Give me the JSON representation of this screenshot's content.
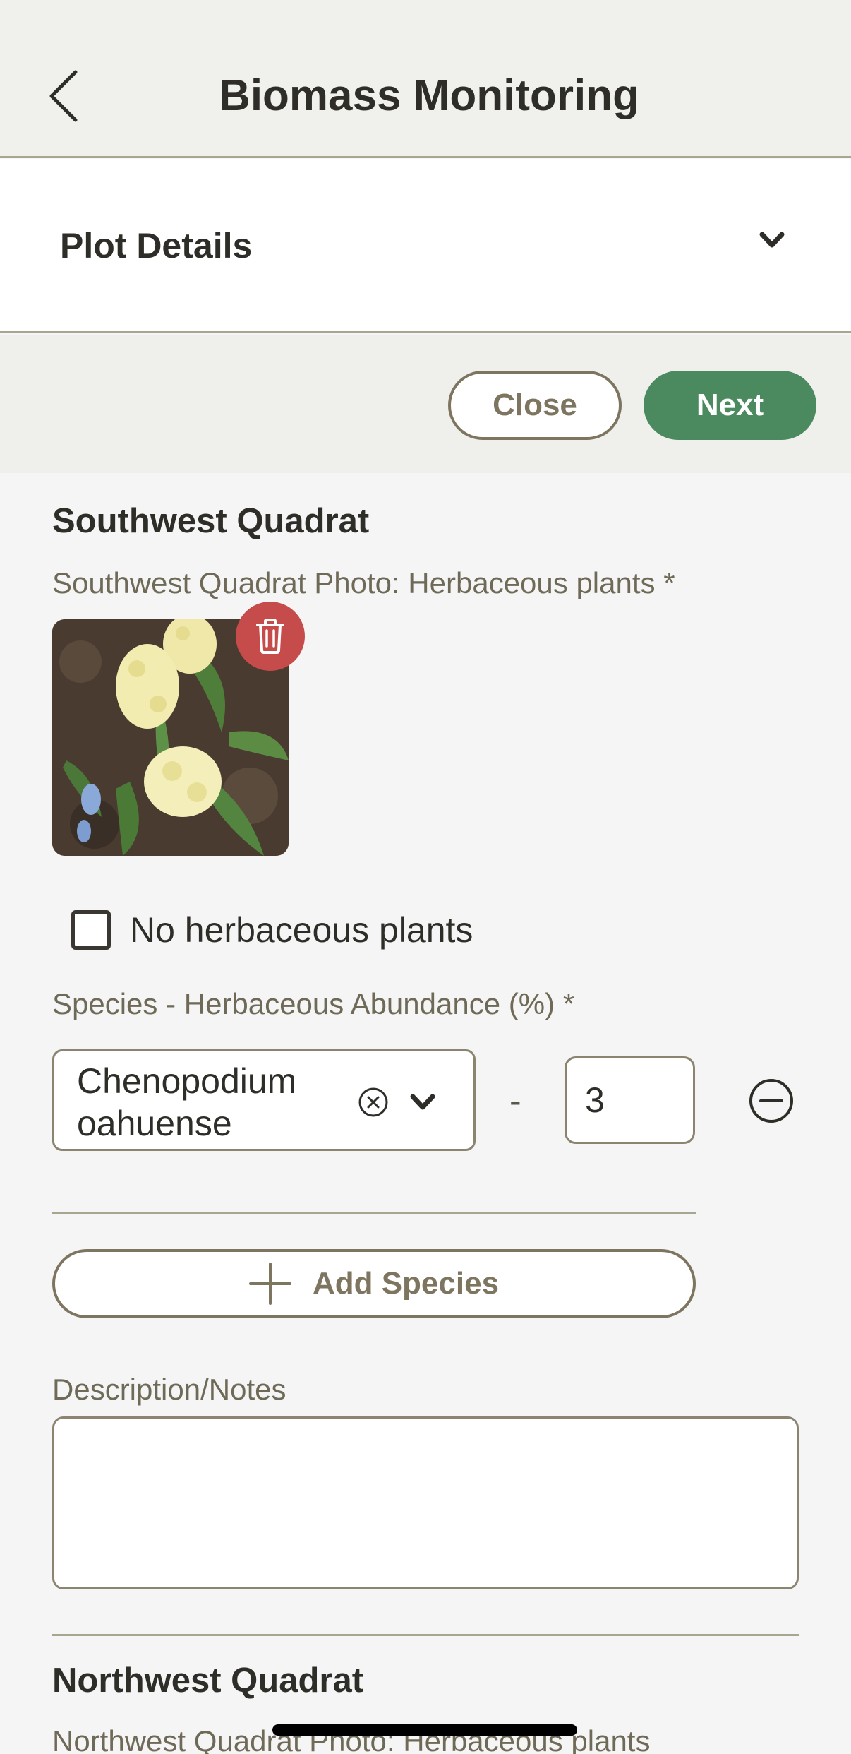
{
  "header": {
    "title": "Biomass Monitoring",
    "back_icon": "chevron-left-icon"
  },
  "plot_details": {
    "label": "Plot Details",
    "expand_icon": "chevron-down-icon"
  },
  "actions": {
    "close_label": "Close",
    "next_label": "Next"
  },
  "southwest": {
    "title": "Southwest Quadrat",
    "photo_label": "Southwest Quadrat Photo: Herbaceous plants *",
    "delete_icon": "trash-icon",
    "no_plants_label": "No herbaceous plants",
    "no_plants_checked": false,
    "species_label": "Species - Herbaceous Abundance (%) *",
    "species": [
      {
        "name": "Chenopodium oahuense",
        "abundance": "3"
      }
    ],
    "dash": "-",
    "add_species_label": "Add Species",
    "notes_label": "Description/Notes",
    "notes_value": ""
  },
  "northwest": {
    "title": "Northwest Quadrat",
    "photo_label": "Northwest Quadrat Photo: Herbaceous plants"
  },
  "colors": {
    "accent_green": "#4a8a5e",
    "delete_red": "#c64b4b",
    "outline_brown": "#7d7560"
  }
}
